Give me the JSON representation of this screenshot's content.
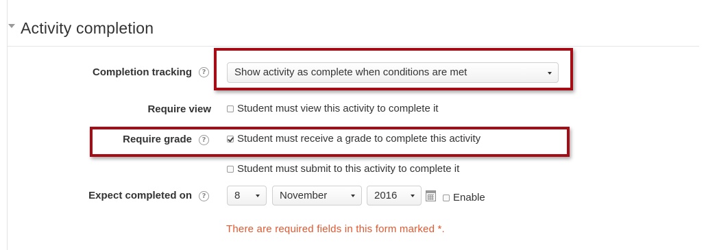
{
  "section": {
    "title": "Activity completion"
  },
  "fields": {
    "completion_tracking": {
      "label": "Completion tracking",
      "value": "Show activity as complete when conditions are met"
    },
    "require_view": {
      "label": "Require view",
      "checkbox_label": "Student must view this activity to complete it",
      "checked": false
    },
    "require_grade": {
      "label": "Require grade",
      "checkbox_label": "Student must receive a grade to complete this activity",
      "checked": true
    },
    "require_submit": {
      "checkbox_label": "Student must submit to this activity to complete it",
      "checked": false
    },
    "expect_completed": {
      "label": "Expect completed on",
      "day": "8",
      "month": "November",
      "year": "2016",
      "enable_label": "Enable",
      "enabled": false
    }
  },
  "required_note": "There are required fields in this form marked *.",
  "help_glyph": "?",
  "colors": {
    "highlight": "#a50d16",
    "required_note": "#e4572e"
  }
}
